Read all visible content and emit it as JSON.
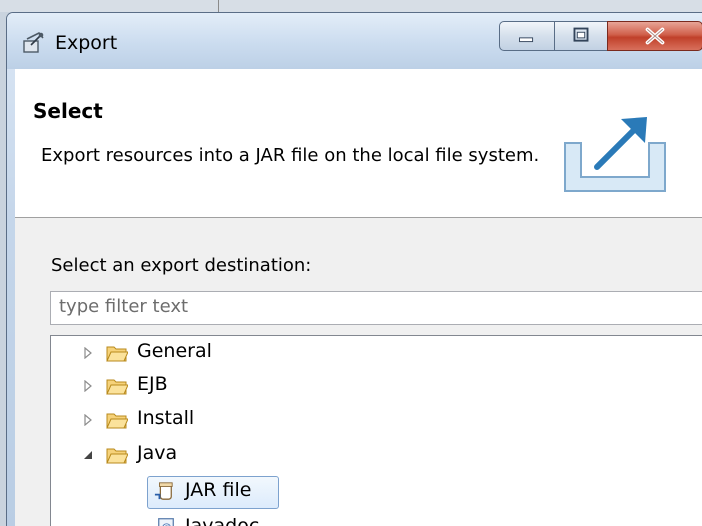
{
  "window": {
    "title": "Export",
    "controls": [
      "minimize",
      "maximize",
      "close"
    ]
  },
  "header": {
    "title": "Select",
    "description": "Export resources into a JAR file on the local file system."
  },
  "destination": {
    "label": "Select an export destination:",
    "filter_placeholder": "type filter text"
  },
  "tree": {
    "items": [
      {
        "label": "General",
        "expanded": false,
        "icon": "folder-icon"
      },
      {
        "label": "EJB",
        "expanded": false,
        "icon": "folder-icon"
      },
      {
        "label": "Install",
        "expanded": false,
        "icon": "folder-icon"
      },
      {
        "label": "Java",
        "expanded": true,
        "icon": "folder-open-icon"
      },
      {
        "label": "JAR file",
        "selected": true,
        "icon": "jar-icon"
      },
      {
        "label": "Javadoc",
        "icon": "javadoc-icon"
      }
    ]
  },
  "colors": {
    "accent": "#7da2ce",
    "folder": "#e8b84a",
    "close": "#c0402a"
  }
}
